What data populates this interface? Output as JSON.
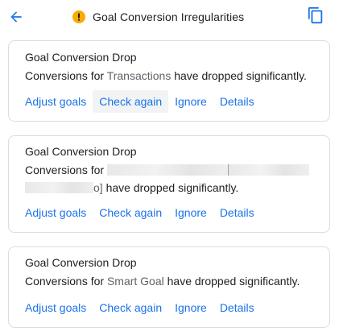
{
  "header": {
    "title": "Goal Conversion Irregularities",
    "back_icon": "arrow-back-icon",
    "warning_icon": "warning-icon",
    "copy_icon": "copy-icon"
  },
  "colors": {
    "accent": "#1a73e8",
    "warning": "#f9ab00",
    "border": "#dadce0",
    "metric": "#5f6368"
  },
  "alerts": [
    {
      "title": "Goal Conversion Drop",
      "text_prefix": "Conversions for ",
      "metric": "Transactions",
      "text_suffix": " have dropped significantly.",
      "actions": [
        "Adjust goals",
        "Check again",
        "Ignore",
        "Details"
      ]
    },
    {
      "title": "Goal Conversion Drop",
      "text_prefix": "Conversions for ",
      "metric_tail": "o]",
      "text_suffix": " have dropped significantly.",
      "actions": [
        "Adjust goals",
        "Check again",
        "Ignore",
        "Details"
      ]
    },
    {
      "title": "Goal Conversion Drop",
      "text_prefix": "Conversions for ",
      "metric": "Smart Goal",
      "text_suffix": " have dropped significantly.",
      "actions": [
        "Adjust goals",
        "Check again",
        "Ignore",
        "Details"
      ]
    }
  ]
}
